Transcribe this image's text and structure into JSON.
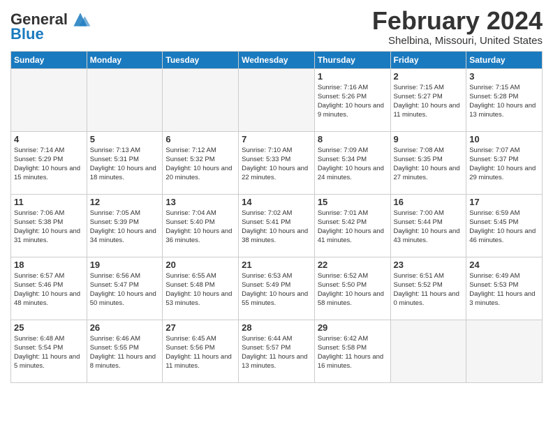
{
  "logo": {
    "text_general": "General",
    "text_blue": "Blue"
  },
  "header": {
    "title": "February 2024",
    "subtitle": "Shelbina, Missouri, United States"
  },
  "days_of_week": [
    "Sunday",
    "Monday",
    "Tuesday",
    "Wednesday",
    "Thursday",
    "Friday",
    "Saturday"
  ],
  "weeks": [
    [
      {
        "day": "",
        "empty": true
      },
      {
        "day": "",
        "empty": true
      },
      {
        "day": "",
        "empty": true
      },
      {
        "day": "",
        "empty": true
      },
      {
        "day": "1",
        "sunrise": "7:16 AM",
        "sunset": "5:26 PM",
        "daylight": "10 hours and 9 minutes."
      },
      {
        "day": "2",
        "sunrise": "7:15 AM",
        "sunset": "5:27 PM",
        "daylight": "10 hours and 11 minutes."
      },
      {
        "day": "3",
        "sunrise": "7:15 AM",
        "sunset": "5:28 PM",
        "daylight": "10 hours and 13 minutes."
      }
    ],
    [
      {
        "day": "4",
        "sunrise": "7:14 AM",
        "sunset": "5:29 PM",
        "daylight": "10 hours and 15 minutes."
      },
      {
        "day": "5",
        "sunrise": "7:13 AM",
        "sunset": "5:31 PM",
        "daylight": "10 hours and 18 minutes."
      },
      {
        "day": "6",
        "sunrise": "7:12 AM",
        "sunset": "5:32 PM",
        "daylight": "10 hours and 20 minutes."
      },
      {
        "day": "7",
        "sunrise": "7:10 AM",
        "sunset": "5:33 PM",
        "daylight": "10 hours and 22 minutes."
      },
      {
        "day": "8",
        "sunrise": "7:09 AM",
        "sunset": "5:34 PM",
        "daylight": "10 hours and 24 minutes."
      },
      {
        "day": "9",
        "sunrise": "7:08 AM",
        "sunset": "5:35 PM",
        "daylight": "10 hours and 27 minutes."
      },
      {
        "day": "10",
        "sunrise": "7:07 AM",
        "sunset": "5:37 PM",
        "daylight": "10 hours and 29 minutes."
      }
    ],
    [
      {
        "day": "11",
        "sunrise": "7:06 AM",
        "sunset": "5:38 PM",
        "daylight": "10 hours and 31 minutes."
      },
      {
        "day": "12",
        "sunrise": "7:05 AM",
        "sunset": "5:39 PM",
        "daylight": "10 hours and 34 minutes."
      },
      {
        "day": "13",
        "sunrise": "7:04 AM",
        "sunset": "5:40 PM",
        "daylight": "10 hours and 36 minutes."
      },
      {
        "day": "14",
        "sunrise": "7:02 AM",
        "sunset": "5:41 PM",
        "daylight": "10 hours and 38 minutes."
      },
      {
        "day": "15",
        "sunrise": "7:01 AM",
        "sunset": "5:42 PM",
        "daylight": "10 hours and 41 minutes."
      },
      {
        "day": "16",
        "sunrise": "7:00 AM",
        "sunset": "5:44 PM",
        "daylight": "10 hours and 43 minutes."
      },
      {
        "day": "17",
        "sunrise": "6:59 AM",
        "sunset": "5:45 PM",
        "daylight": "10 hours and 46 minutes."
      }
    ],
    [
      {
        "day": "18",
        "sunrise": "6:57 AM",
        "sunset": "5:46 PM",
        "daylight": "10 hours and 48 minutes."
      },
      {
        "day": "19",
        "sunrise": "6:56 AM",
        "sunset": "5:47 PM",
        "daylight": "10 hours and 50 minutes."
      },
      {
        "day": "20",
        "sunrise": "6:55 AM",
        "sunset": "5:48 PM",
        "daylight": "10 hours and 53 minutes."
      },
      {
        "day": "21",
        "sunrise": "6:53 AM",
        "sunset": "5:49 PM",
        "daylight": "10 hours and 55 minutes."
      },
      {
        "day": "22",
        "sunrise": "6:52 AM",
        "sunset": "5:50 PM",
        "daylight": "10 hours and 58 minutes."
      },
      {
        "day": "23",
        "sunrise": "6:51 AM",
        "sunset": "5:52 PM",
        "daylight": "11 hours and 0 minutes."
      },
      {
        "day": "24",
        "sunrise": "6:49 AM",
        "sunset": "5:53 PM",
        "daylight": "11 hours and 3 minutes."
      }
    ],
    [
      {
        "day": "25",
        "sunrise": "6:48 AM",
        "sunset": "5:54 PM",
        "daylight": "11 hours and 5 minutes."
      },
      {
        "day": "26",
        "sunrise": "6:46 AM",
        "sunset": "5:55 PM",
        "daylight": "11 hours and 8 minutes."
      },
      {
        "day": "27",
        "sunrise": "6:45 AM",
        "sunset": "5:56 PM",
        "daylight": "11 hours and 11 minutes."
      },
      {
        "day": "28",
        "sunrise": "6:44 AM",
        "sunset": "5:57 PM",
        "daylight": "11 hours and 13 minutes."
      },
      {
        "day": "29",
        "sunrise": "6:42 AM",
        "sunset": "5:58 PM",
        "daylight": "11 hours and 16 minutes."
      },
      {
        "day": "",
        "empty": true
      },
      {
        "day": "",
        "empty": true
      }
    ]
  ]
}
